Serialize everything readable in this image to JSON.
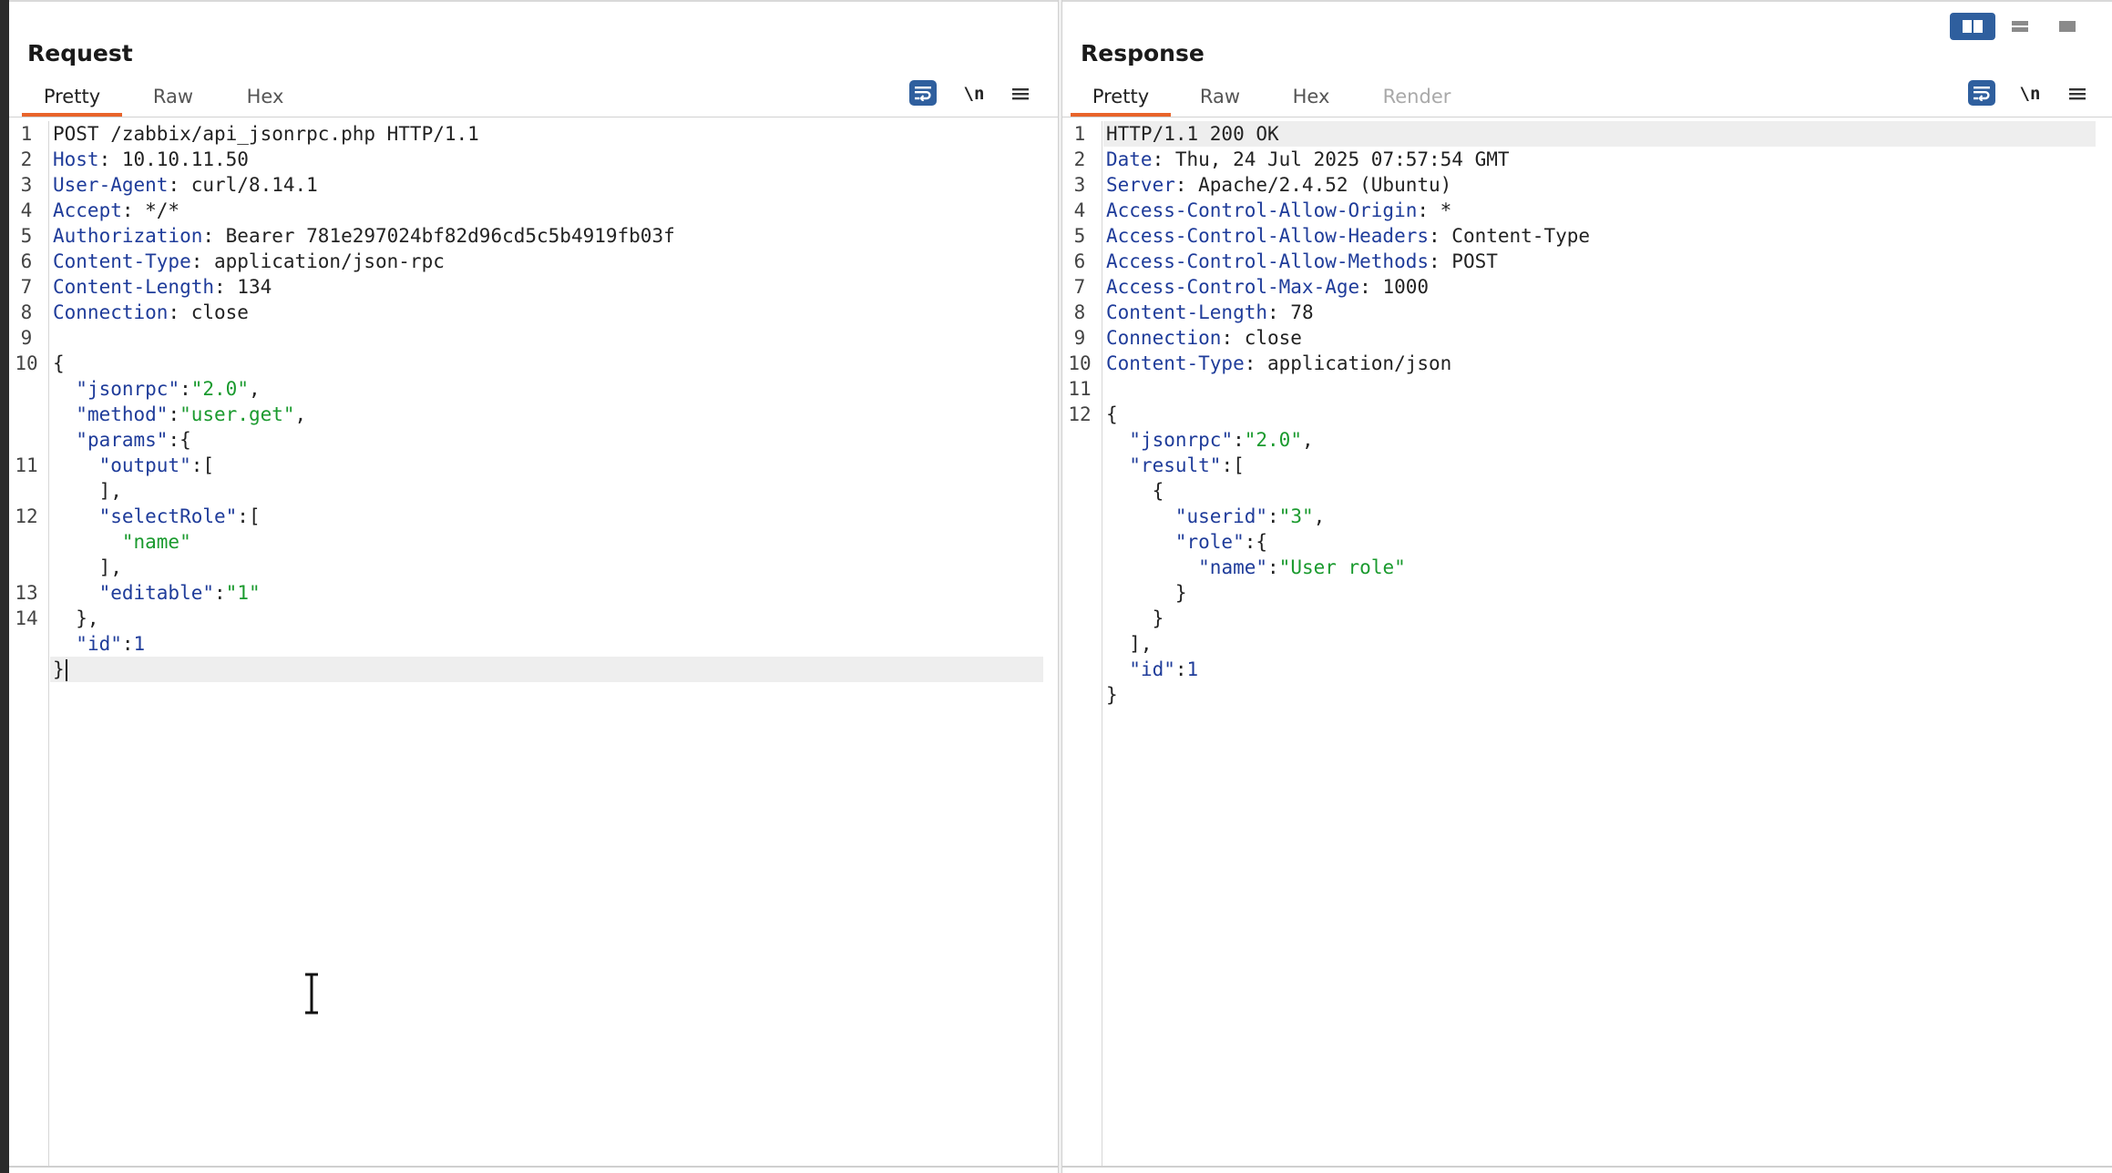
{
  "request": {
    "title": "Request",
    "tabs": [
      {
        "label": "Pretty",
        "active": true
      },
      {
        "label": "Raw"
      },
      {
        "label": "Hex"
      }
    ],
    "newline_toggle": "\\n",
    "lines": [
      {
        "n": "1",
        "parts": [
          [
            "POST /zabbix/api_jsonrpc.php HTTP/1.1",
            ""
          ]
        ]
      },
      {
        "n": "2",
        "parts": [
          [
            "Host",
            "k"
          ],
          [
            ": 10.10.11.50",
            ""
          ]
        ]
      },
      {
        "n": "3",
        "parts": [
          [
            "User-Agent",
            "k"
          ],
          [
            ": curl/8.14.1",
            ""
          ]
        ]
      },
      {
        "n": "4",
        "parts": [
          [
            "Accept",
            "k"
          ],
          [
            ": */*",
            ""
          ]
        ]
      },
      {
        "n": "5",
        "parts": [
          [
            "Authorization",
            "k"
          ],
          [
            ": Bearer 781e297024bf82d96cd5c5b4919fb03f",
            ""
          ]
        ]
      },
      {
        "n": "6",
        "parts": [
          [
            "Content-Type",
            "k"
          ],
          [
            ": application/json-rpc",
            ""
          ]
        ]
      },
      {
        "n": "7",
        "parts": [
          [
            "Content-Length",
            "k"
          ],
          [
            ": 134",
            ""
          ]
        ]
      },
      {
        "n": "8",
        "parts": [
          [
            "Connection",
            "k"
          ],
          [
            ": close",
            ""
          ]
        ]
      },
      {
        "n": "9",
        "parts": []
      },
      {
        "n": "10",
        "parts": [
          [
            "{",
            ""
          ]
        ]
      },
      {
        "n": "",
        "parts": [
          [
            "  ",
            ""
          ],
          [
            "\"jsonrpc\"",
            "k"
          ],
          [
            ":",
            ""
          ],
          [
            "\"2.0\"",
            "s"
          ],
          [
            ",",
            ""
          ]
        ]
      },
      {
        "n": "",
        "parts": [
          [
            "  ",
            ""
          ],
          [
            "\"method\"",
            "k"
          ],
          [
            ":",
            ""
          ],
          [
            "\"user.get\"",
            "s"
          ],
          [
            ",",
            ""
          ]
        ]
      },
      {
        "n": "",
        "parts": [
          [
            "  ",
            ""
          ],
          [
            "\"params\"",
            "k"
          ],
          [
            ":{",
            ""
          ]
        ]
      },
      {
        "n": "11",
        "parts": [
          [
            "    ",
            ""
          ],
          [
            "\"output\"",
            "k"
          ],
          [
            ":[",
            ""
          ]
        ]
      },
      {
        "n": "",
        "parts": [
          [
            "    ],",
            ""
          ]
        ]
      },
      {
        "n": "12",
        "parts": [
          [
            "    ",
            ""
          ],
          [
            "\"selectRole\"",
            "k"
          ],
          [
            ":[",
            ""
          ]
        ]
      },
      {
        "n": "",
        "parts": [
          [
            "      ",
            ""
          ],
          [
            "\"name\"",
            "s"
          ]
        ]
      },
      {
        "n": "",
        "parts": [
          [
            "    ],",
            ""
          ]
        ]
      },
      {
        "n": "13",
        "parts": [
          [
            "    ",
            ""
          ],
          [
            "\"editable\"",
            "k"
          ],
          [
            ":",
            ""
          ],
          [
            "\"1\"",
            "s"
          ]
        ]
      },
      {
        "n": "14",
        "parts": [
          [
            "  },",
            ""
          ]
        ]
      },
      {
        "n": "",
        "parts": [
          [
            "  ",
            ""
          ],
          [
            "\"id\"",
            "k"
          ],
          [
            ":",
            ""
          ],
          [
            "1",
            "n"
          ]
        ]
      },
      {
        "n": "",
        "parts": [
          [
            "}",
            ""
          ]
        ],
        "current": true,
        "caret": true
      }
    ]
  },
  "response": {
    "title": "Response",
    "tabs": [
      {
        "label": "Pretty",
        "active": true
      },
      {
        "label": "Raw"
      },
      {
        "label": "Hex"
      },
      {
        "label": "Render",
        "disabled": true
      }
    ],
    "newline_toggle": "\\n",
    "lines": [
      {
        "n": "1",
        "parts": [
          [
            "HTTP/1.1 200 OK",
            ""
          ]
        ],
        "current": true
      },
      {
        "n": "2",
        "parts": [
          [
            "Date",
            "k"
          ],
          [
            ": Thu, 24 Jul 2025 07:57:54 GMT",
            ""
          ]
        ]
      },
      {
        "n": "3",
        "parts": [
          [
            "Server",
            "k"
          ],
          [
            ": Apache/2.4.52 (Ubuntu)",
            ""
          ]
        ]
      },
      {
        "n": "4",
        "parts": [
          [
            "Access-Control-Allow-Origin",
            "k"
          ],
          [
            ": *",
            ""
          ]
        ]
      },
      {
        "n": "5",
        "parts": [
          [
            "Access-Control-Allow-Headers",
            "k"
          ],
          [
            ": Content-Type",
            ""
          ]
        ]
      },
      {
        "n": "6",
        "parts": [
          [
            "Access-Control-Allow-Methods",
            "k"
          ],
          [
            ": POST",
            ""
          ]
        ]
      },
      {
        "n": "7",
        "parts": [
          [
            "Access-Control-Max-Age",
            "k"
          ],
          [
            ": 1000",
            ""
          ]
        ]
      },
      {
        "n": "8",
        "parts": [
          [
            "Content-Length",
            "k"
          ],
          [
            ": 78",
            ""
          ]
        ]
      },
      {
        "n": "9",
        "parts": [
          [
            "Connection",
            "k"
          ],
          [
            ": close",
            ""
          ]
        ]
      },
      {
        "n": "10",
        "parts": [
          [
            "Content-Type",
            "k"
          ],
          [
            ": application/json",
            ""
          ]
        ]
      },
      {
        "n": "11",
        "parts": []
      },
      {
        "n": "12",
        "parts": [
          [
            "{",
            ""
          ]
        ]
      },
      {
        "n": "",
        "parts": [
          [
            "  ",
            ""
          ],
          [
            "\"jsonrpc\"",
            "k"
          ],
          [
            ":",
            ""
          ],
          [
            "\"2.0\"",
            "s"
          ],
          [
            ",",
            ""
          ]
        ]
      },
      {
        "n": "",
        "parts": [
          [
            "  ",
            ""
          ],
          [
            "\"result\"",
            "k"
          ],
          [
            ":[",
            ""
          ]
        ]
      },
      {
        "n": "",
        "parts": [
          [
            "    {",
            ""
          ]
        ]
      },
      {
        "n": "",
        "parts": [
          [
            "      ",
            ""
          ],
          [
            "\"userid\"",
            "k"
          ],
          [
            ":",
            ""
          ],
          [
            "\"3\"",
            "s"
          ],
          [
            ",",
            ""
          ]
        ]
      },
      {
        "n": "",
        "parts": [
          [
            "      ",
            ""
          ],
          [
            "\"role\"",
            "k"
          ],
          [
            ":{",
            ""
          ]
        ]
      },
      {
        "n": "",
        "parts": [
          [
            "        ",
            ""
          ],
          [
            "\"name\"",
            "k"
          ],
          [
            ":",
            ""
          ],
          [
            "\"User role\"",
            "s"
          ]
        ]
      },
      {
        "n": "",
        "parts": [
          [
            "      }",
            ""
          ]
        ]
      },
      {
        "n": "",
        "parts": [
          [
            "    }",
            ""
          ]
        ]
      },
      {
        "n": "",
        "parts": [
          [
            "  ],",
            ""
          ]
        ]
      },
      {
        "n": "",
        "parts": [
          [
            "  ",
            ""
          ],
          [
            "\"id\"",
            "k"
          ],
          [
            ":",
            ""
          ],
          [
            "1",
            "n"
          ]
        ]
      },
      {
        "n": "",
        "parts": [
          [
            "}",
            ""
          ]
        ]
      }
    ]
  },
  "layout_buttons": [
    {
      "icon": "split-columns-icon",
      "active": true
    },
    {
      "icon": "split-rows-icon"
    },
    {
      "icon": "single-pane-icon"
    }
  ],
  "colors": {
    "accent": "#e8642a",
    "button_blue": "#2f5f9e",
    "key": "#1f3c9a",
    "string": "#1a9a2e"
  }
}
